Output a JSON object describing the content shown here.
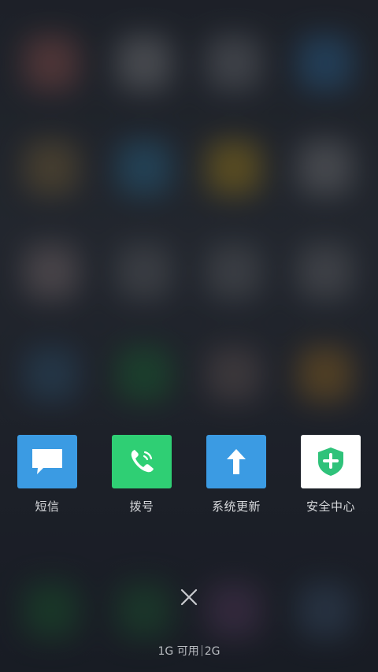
{
  "recent_apps": [
    {
      "label": "短信",
      "icon": "message-icon",
      "color": "#3b9be3"
    },
    {
      "label": "拨号",
      "icon": "phone-icon",
      "color": "#2fcf74"
    },
    {
      "label": "系统更新",
      "icon": "arrow-up-icon",
      "color": "#3b9be3"
    },
    {
      "label": "安全中心",
      "icon": "shield-plus-icon",
      "color": "#ffffff"
    }
  ],
  "close_icon": "close-icon",
  "memory": {
    "available": "1G 可用",
    "total": "2G"
  },
  "colors": {
    "shield_green": "#2fc27a"
  }
}
